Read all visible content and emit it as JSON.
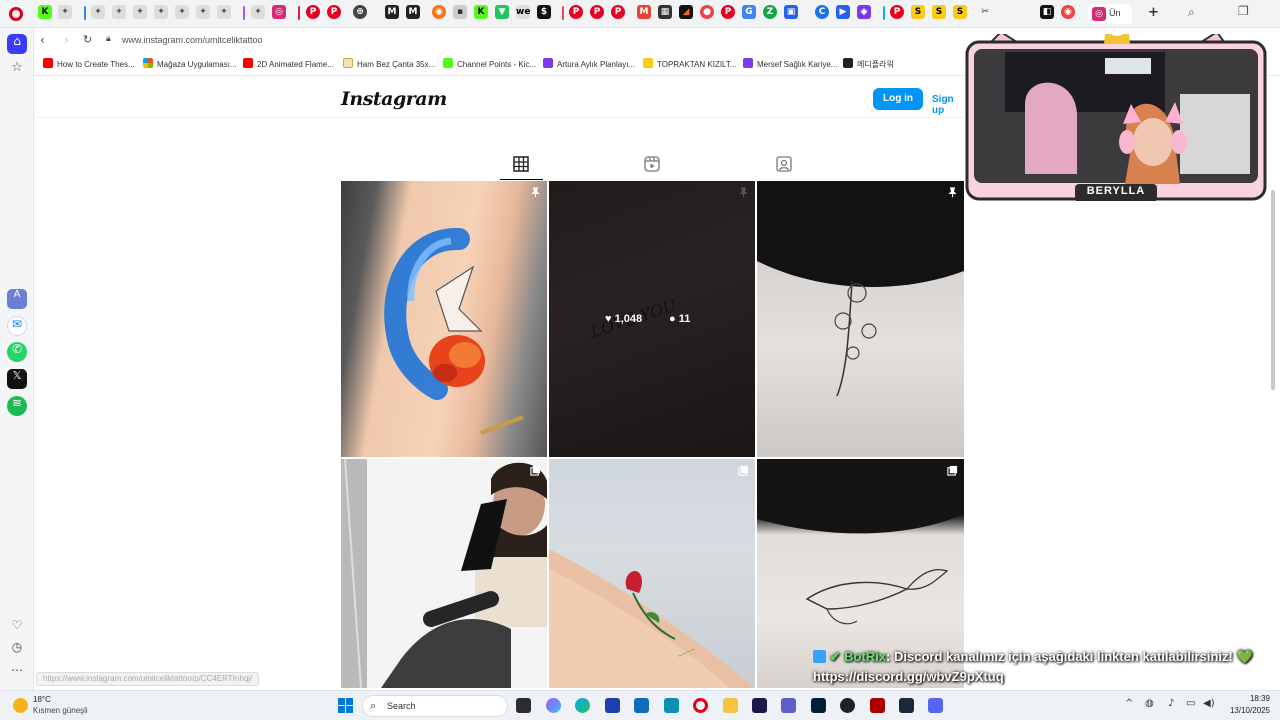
{
  "browser": {
    "url": "www.instagram.com/umitceliktattoo",
    "bookmarks": [
      "How to Create Thes...",
      "Mağaza Uygulaması...",
      "2D Animated Flame...",
      "Ham Bez Çanta 35x...",
      "Channel Points - Kic...",
      "Artura Aylık Planlayı...",
      "TOPRAKTAN KIZILT...",
      "Mersef Sağlık Kariye...",
      "메디플라워"
    ],
    "active_tab_label": "Ün",
    "status_url": "https://www.instagram.com/umitceliktattoo/p/CC4ERTInhqj/"
  },
  "instagram": {
    "logo": "Instagram",
    "login_label": "Log in",
    "signup_label": "Sign up",
    "hover_likes": "1,048",
    "hover_comments": "11"
  },
  "overlay": {
    "streamer_name": "BERYLLA",
    "chat_user": "BotRix",
    "chat_message": ": Discord kanalımız için aşağıdaki linkten katılabilirsiniz!",
    "chat_link": "https://discord.gg/wbvZ9pXtuq",
    "heart_emoji": "💚"
  },
  "taskbar": {
    "weather_temp": "18°C",
    "weather_desc": "Kısmen güneşli",
    "search_placeholder": "Search",
    "time": "18:39",
    "date": "13/10/2025"
  },
  "colors": {
    "instagram_blue": "#0095f6",
    "opera_red": "#e0001b",
    "sidebar_active": "#3b3bff"
  }
}
